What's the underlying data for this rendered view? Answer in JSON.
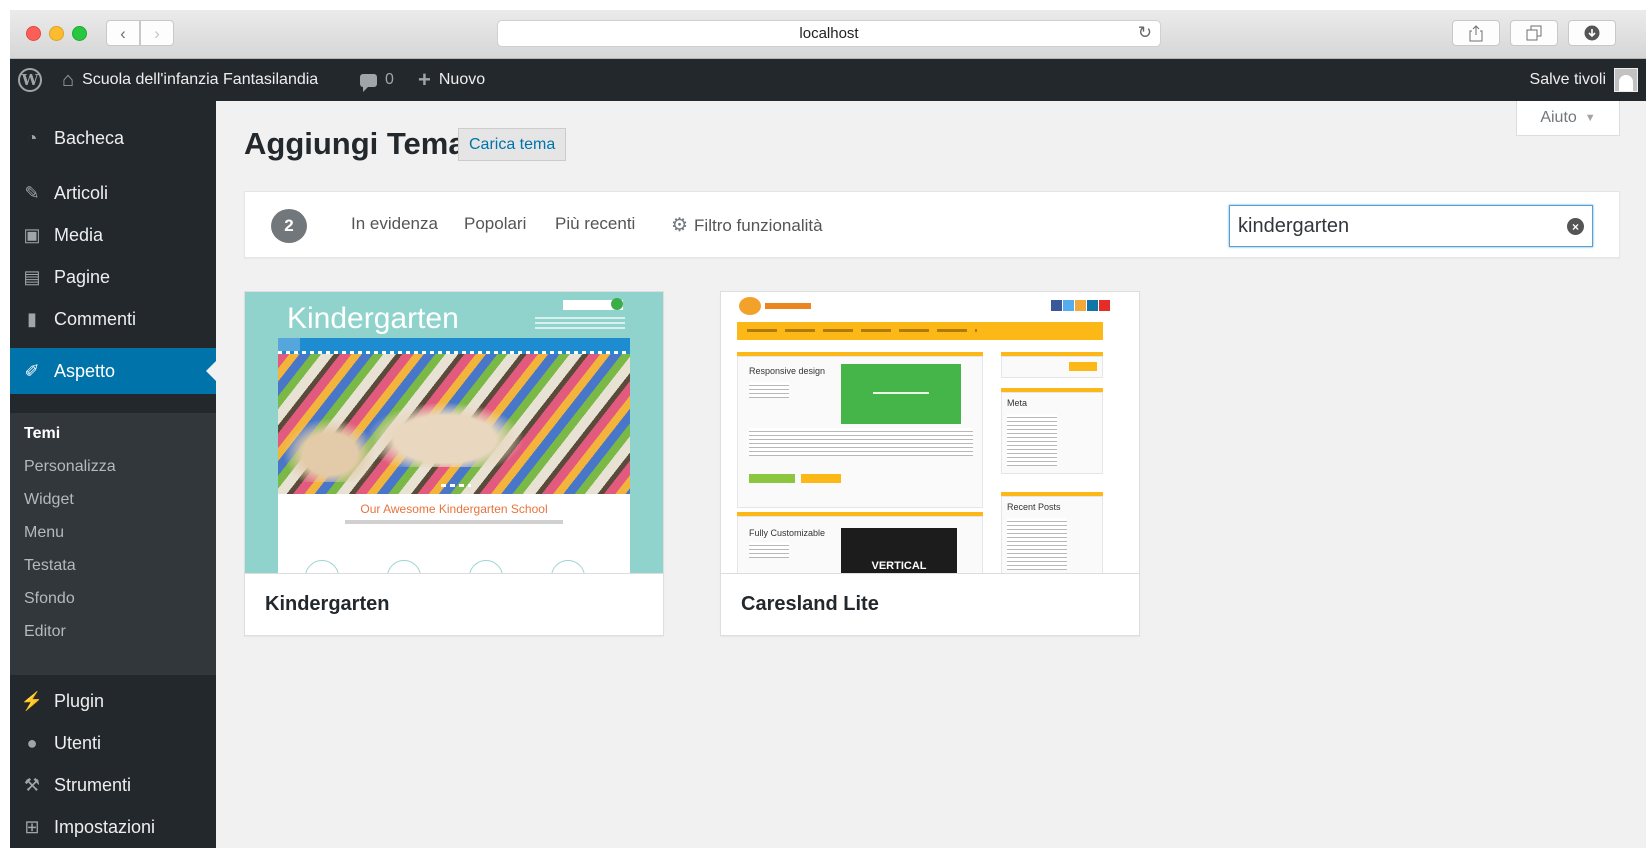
{
  "browser": {
    "url": "localhost"
  },
  "admin_bar": {
    "site_name": "Scuola dell'infanzia Fantasilandia",
    "comments_count": "0",
    "new_label": "Nuovo",
    "user_greeting": "Salve tivoli"
  },
  "sidebar": {
    "items": [
      {
        "label": "Bacheca",
        "icon": "dashboard-icon"
      },
      {
        "label": "Articoli",
        "icon": "pin-icon"
      },
      {
        "label": "Media",
        "icon": "media-icon"
      },
      {
        "label": "Pagine",
        "icon": "pages-icon"
      },
      {
        "label": "Commenti",
        "icon": "comment-icon"
      },
      {
        "label": "Aspetto",
        "icon": "brush-icon"
      },
      {
        "label": "Plugin",
        "icon": "plug-icon"
      },
      {
        "label": "Utenti",
        "icon": "user-icon"
      },
      {
        "label": "Strumenti",
        "icon": "wrench-icon"
      },
      {
        "label": "Impostazioni",
        "icon": "settings-icon"
      }
    ],
    "submenu": [
      "Temi",
      "Personalizza",
      "Widget",
      "Menu",
      "Testata",
      "Sfondo",
      "Editor"
    ]
  },
  "content": {
    "help_label": "Aiuto",
    "page_title": "Aggiungi Tema",
    "upload_button": "Carica tema",
    "filter": {
      "count": "2",
      "tabs": [
        "In evidenza",
        "Popolari",
        "Più recenti"
      ],
      "feature_filter": "Filtro funzionalità",
      "search_value": "kindergarten"
    },
    "themes": [
      {
        "name": "Kindergarten",
        "preview_logo": "Kindergarten",
        "preview_tagline": "Our Awesome Kindergarten School"
      },
      {
        "name": "Caresland Lite",
        "preview_post1": "Responsive design",
        "preview_post2": "Fully Customizable",
        "preview_widget1": "Meta",
        "preview_widget2": "Recent Posts",
        "preview_banner": "VERTICAL"
      }
    ]
  },
  "colors": {
    "admin_dark": "#23282d",
    "accent_blue": "#0073aa",
    "submenu_bg": "#32373c",
    "content_bg": "#f1f1f1"
  }
}
